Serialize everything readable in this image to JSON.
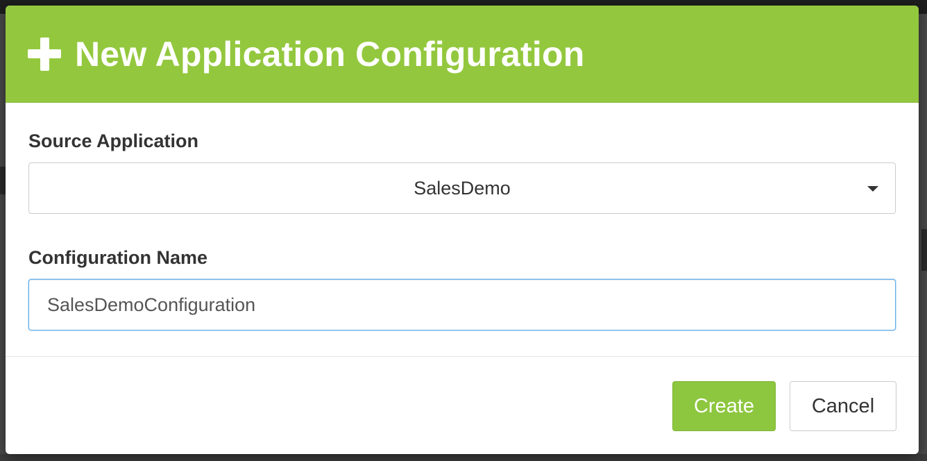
{
  "modal": {
    "title": "New Application Configuration",
    "icon": "plus-icon",
    "header_color": "#93c83e"
  },
  "form": {
    "source_application": {
      "label": "Source Application",
      "selected_value": "SalesDemo"
    },
    "configuration_name": {
      "label": "Configuration Name",
      "value": "SalesDemoConfiguration"
    }
  },
  "footer": {
    "create_label": "Create",
    "cancel_label": "Cancel",
    "create_color": "#8dc63f"
  }
}
